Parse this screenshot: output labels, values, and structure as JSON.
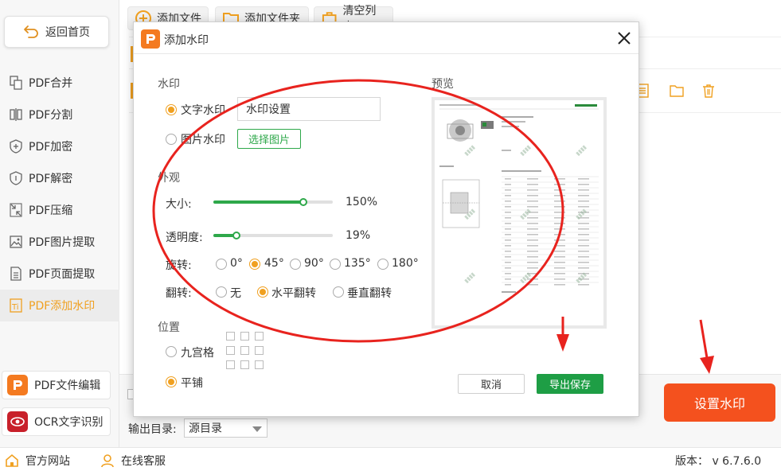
{
  "sidebar": {
    "back_label": "返回首页",
    "items": [
      {
        "label": "PDF合并",
        "icon": "merge-icon"
      },
      {
        "label": "PDF分割",
        "icon": "split-icon"
      },
      {
        "label": "PDF加密",
        "icon": "lock-shield-icon"
      },
      {
        "label": "PDF解密",
        "icon": "unlock-shield-icon"
      },
      {
        "label": "PDF压缩",
        "icon": "compress-icon"
      },
      {
        "label": "PDF图片提取",
        "icon": "image-icon"
      },
      {
        "label": "PDF页面提取",
        "icon": "page-icon"
      },
      {
        "label": "PDF添加水印",
        "icon": "watermark-icon",
        "active": true
      }
    ],
    "bottom": [
      {
        "label": "PDF文件编辑",
        "icon": "pdf-editor-app-icon"
      },
      {
        "label": "OCR文字识别",
        "icon": "ocr-eye-app-icon"
      }
    ]
  },
  "toolbar": {
    "add_file": "添加文件",
    "add_folder": "添加文件夹",
    "clear_list": "清空列表"
  },
  "output": {
    "label": "输出目录:",
    "selected": "源目录"
  },
  "set_watermark_button": "设置水印",
  "status": {
    "website": "官方网站",
    "support": "在线客服",
    "version": "版本： v 6.7.6.0"
  },
  "dialog": {
    "title": "添加水印",
    "watermark_section": "水印",
    "text_option": "文字水印",
    "text_value": "水印设置",
    "image_option": "图片水印",
    "select_image_button": "选择图片",
    "appearance_section": "外观",
    "size_label": "大小:",
    "size_value": "150%",
    "size_fraction": 0.75,
    "opacity_label": "透明度:",
    "opacity_value": "19%",
    "opacity_fraction": 0.19,
    "rotate_label": "旋转:",
    "rotate_options": [
      "0°",
      "45°",
      "90°",
      "135°",
      "180°"
    ],
    "rotate_selected": 1,
    "flip_label": "翻转:",
    "flip_options": [
      "无",
      "水平翻转",
      "垂直翻转"
    ],
    "flip_selected": 1,
    "position_section": "位置",
    "grid_option": "九宫格",
    "tile_option": "平铺",
    "preview_label": "预览",
    "cancel_button": "取消",
    "export_button": "导出保存"
  },
  "colors": {
    "accent": "#f0a020",
    "green": "#2ea84a",
    "orange_button": "#f4511e",
    "annotation_red": "#e8231e"
  }
}
